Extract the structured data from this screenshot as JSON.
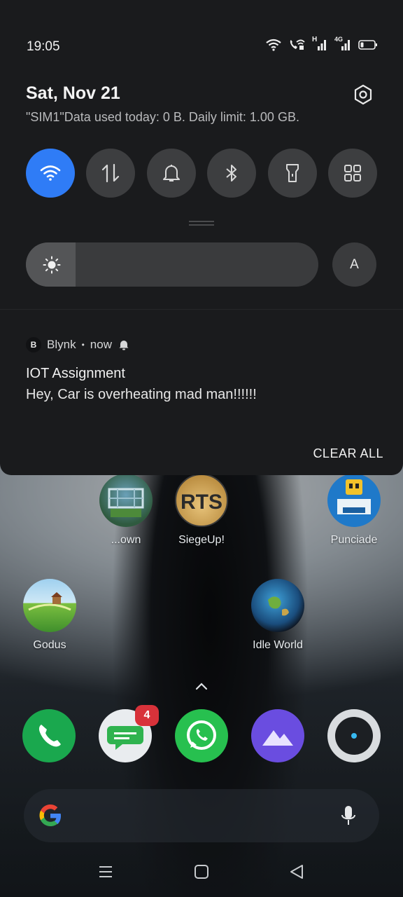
{
  "status_bar": {
    "time": "19:05",
    "icons": [
      "wifi-icon",
      "wifi-calling-icon",
      "signal-h-icon",
      "signal-4g-icon",
      "battery-icon"
    ],
    "network_h": "H",
    "network_4g": "4G"
  },
  "shade": {
    "date": "Sat, Nov 21",
    "data_usage": "\"SIM1\"Data used today: 0 B. Daily limit: 1.00 GB.",
    "quick_tiles": [
      {
        "name": "wifi",
        "icon": "wifi-icon",
        "active": true
      },
      {
        "name": "mobile-data",
        "icon": "data-arrows-icon",
        "active": false
      },
      {
        "name": "sound",
        "icon": "bell-icon",
        "active": false
      },
      {
        "name": "bluetooth",
        "icon": "bluetooth-icon",
        "active": false
      },
      {
        "name": "flashlight",
        "icon": "flashlight-icon",
        "active": false
      },
      {
        "name": "edit-tiles",
        "icon": "grid-icon",
        "active": false
      }
    ],
    "brightness_level": 0.17,
    "auto_brightness_label": "A",
    "accent_color": "#2f7cf6"
  },
  "notification": {
    "app_icon_letter": "B",
    "app_name": "Blynk",
    "separator": "•",
    "time": "now",
    "title": "IOT Assignment",
    "body": "Hey, Car is overheating mad man!!!!!!",
    "clear_all_label": "CLEAR ALL"
  },
  "home": {
    "apps_row1": [
      {
        "label": "...own",
        "icon": "townsmen-icon"
      },
      {
        "label": "SiegeUp!",
        "icon": "siegeup-icon",
        "icon_text": "RTS"
      },
      {
        "label": "Punciade",
        "icon": "robot-game-icon"
      }
    ],
    "apps_row2": [
      {
        "label": "Godus",
        "icon": "godus-icon"
      },
      {
        "label": "Idle World",
        "icon": "globe-icon"
      }
    ],
    "dock": [
      {
        "name": "phone",
        "icon": "phone-icon",
        "color": "#1aa84e"
      },
      {
        "name": "messages",
        "icon": "message-icon",
        "color": "#e9ecef",
        "badge": "4"
      },
      {
        "name": "whatsapp",
        "icon": "whatsapp-icon",
        "color": "#27c04f"
      },
      {
        "name": "gallery",
        "icon": "mountain-icon",
        "color": "#6a4de0"
      },
      {
        "name": "camera",
        "icon": "camera-icon",
        "color": "#d9dcdf"
      }
    ]
  },
  "nav_bar": [
    "menu-icon",
    "home-icon",
    "back-icon"
  ]
}
